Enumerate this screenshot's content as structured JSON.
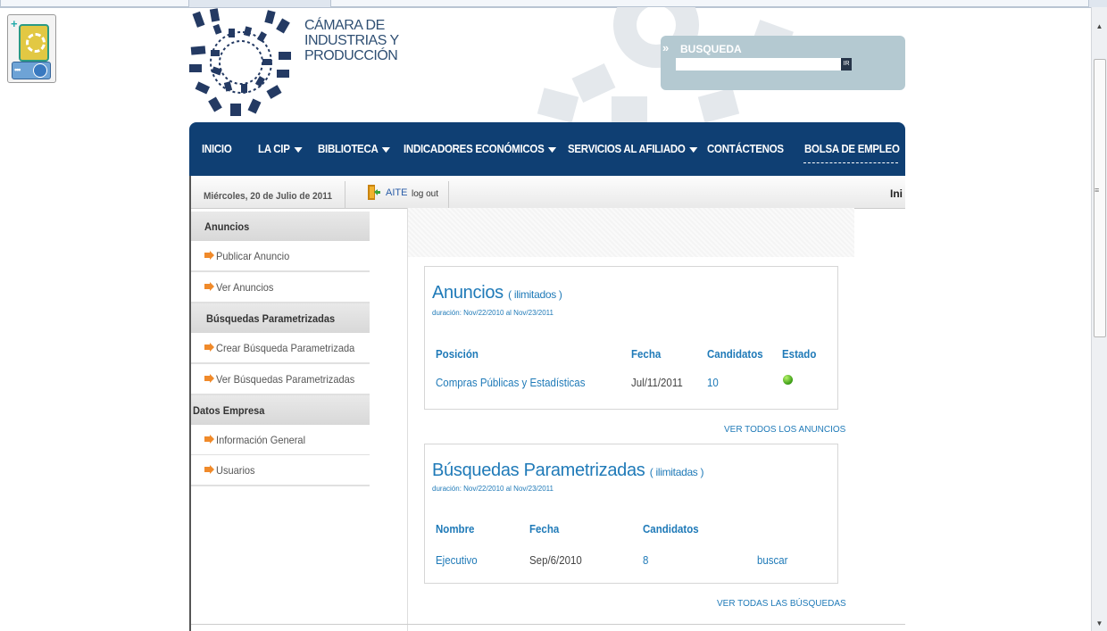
{
  "header": {
    "logo_text": [
      "CÁMARA DE",
      "INDUSTRIAS Y",
      "PRODUCCIÓN"
    ],
    "search": {
      "label": "BUSQUEDA",
      "value": "",
      "placeholder": "",
      "go_label": "IR"
    }
  },
  "nav": {
    "items": [
      {
        "label": "INICIO",
        "dropdown": false
      },
      {
        "label": "LA CIP",
        "dropdown": true
      },
      {
        "label": "BIBLIOTECA",
        "dropdown": true
      },
      {
        "label": "INDICADORES ECONÓMICOS",
        "dropdown": true
      },
      {
        "label": "SERVICIOS AL AFILIADO",
        "dropdown": true
      },
      {
        "label": "CONTÁCTENOS",
        "dropdown": false
      },
      {
        "label": "BOLSA DE EMPLEO",
        "dropdown": false
      }
    ]
  },
  "infobar": {
    "date": "Miércoles, 20 de Julio de 2011",
    "user": "AITE",
    "logout": "log out",
    "right_text": "Ini"
  },
  "sidebar": {
    "sections": [
      {
        "title": "Anuncios",
        "items": [
          "Publicar Anuncio",
          "Ver Anuncios"
        ]
      },
      {
        "title": "Búsquedas Parametrizadas",
        "items": [
          "Crear Búsqueda Parametrizada",
          "Ver Búsquedas Parametrizadas"
        ]
      },
      {
        "title": "Datos Empresa",
        "items": [
          "Información General",
          "Usuarios"
        ]
      }
    ]
  },
  "anuncios": {
    "title": "Anuncios",
    "limit": "( ilimitados )",
    "duration": "duración: Nov/22/2010 al Nov/23/2011",
    "headers": [
      "Posición",
      "Fecha",
      "Candidatos",
      "Estado"
    ],
    "rows": [
      {
        "posicion": "Compras Públicas y Estadísticas",
        "fecha": "Jul/11/2011",
        "candidatos": "10",
        "estado": "active"
      }
    ],
    "status_color": "#3a9b14",
    "view_all": "VER TODOS LOS ANUNCIOS"
  },
  "busquedas": {
    "title": "Búsquedas Parametrizadas",
    "limit": "( ilimitadas )",
    "duration": "duración: Nov/22/2010 al Nov/23/2011",
    "headers": [
      "Nombre",
      "Fecha",
      "Candidatos"
    ],
    "rows": [
      {
        "nombre": "Ejecutivo",
        "fecha": "Sep/6/2010",
        "candidatos": "8",
        "action": "buscar"
      }
    ],
    "view_all": "VER TODAS LAS BÚSQUEDAS"
  },
  "colors": {
    "nav_bg": "#0f3f73",
    "link": "#1f7ab8",
    "accent": "#f08a2a",
    "search_bg": "#b4c9d1"
  }
}
